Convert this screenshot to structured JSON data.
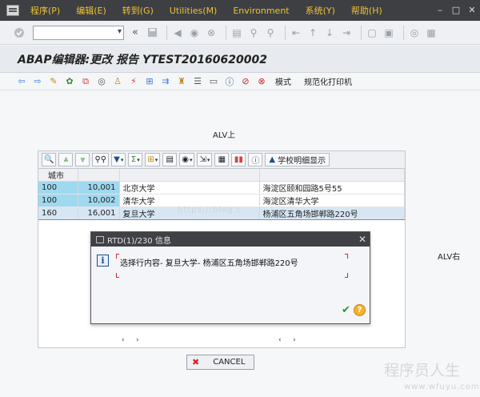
{
  "menubar": {
    "items": [
      "程序(P)",
      "编辑(E)",
      "转到(G)",
      "Utilities(M)",
      "Environment",
      "系统(Y)",
      "帮助(H)"
    ],
    "window_buttons": [
      "–",
      "□",
      "✕"
    ]
  },
  "system_toolbar": {
    "command_field_value": ""
  },
  "title": "ABAP编辑器:更改 报告 YTEST20160620002",
  "app_toolbar": {
    "mode_label": "模式",
    "pretty_printer_label": "规范化打印机"
  },
  "labels": {
    "alv_top": "ALV上",
    "alv_right": "ALV右"
  },
  "alv": {
    "toolbar_button_label": "学校明细显示",
    "columns": [
      "城市",
      "",
      "",
      ""
    ],
    "rows": [
      {
        "city": "100",
        "num": "10,001",
        "name": "北京大学",
        "address": "海淀区颐和园路5号55"
      },
      {
        "city": "100",
        "num": "10,002",
        "name": "清华大学",
        "address": "海淀区清华大学"
      },
      {
        "city": "160",
        "num": "16,001",
        "name": "复旦大学",
        "address": "杨浦区五角场邯郸路220号"
      }
    ],
    "selected_row": 2
  },
  "dialog": {
    "title": "RTD(1)/230 信息",
    "message": "选择行内容-  复旦大学-  杨浦区五角场邯郸路220号"
  },
  "cancel_button_label": "CANCEL",
  "watermark": {
    "overlay_text": "https://blog.c",
    "brand_cn": "程序员人生",
    "brand_url": "www.wfuyu.com"
  },
  "colors": {
    "menubar_bg": "#3d3f43",
    "menu_text": "#f1c232",
    "key_cell": "#9fd9ef",
    "selected_row": "#d8e6f3"
  }
}
